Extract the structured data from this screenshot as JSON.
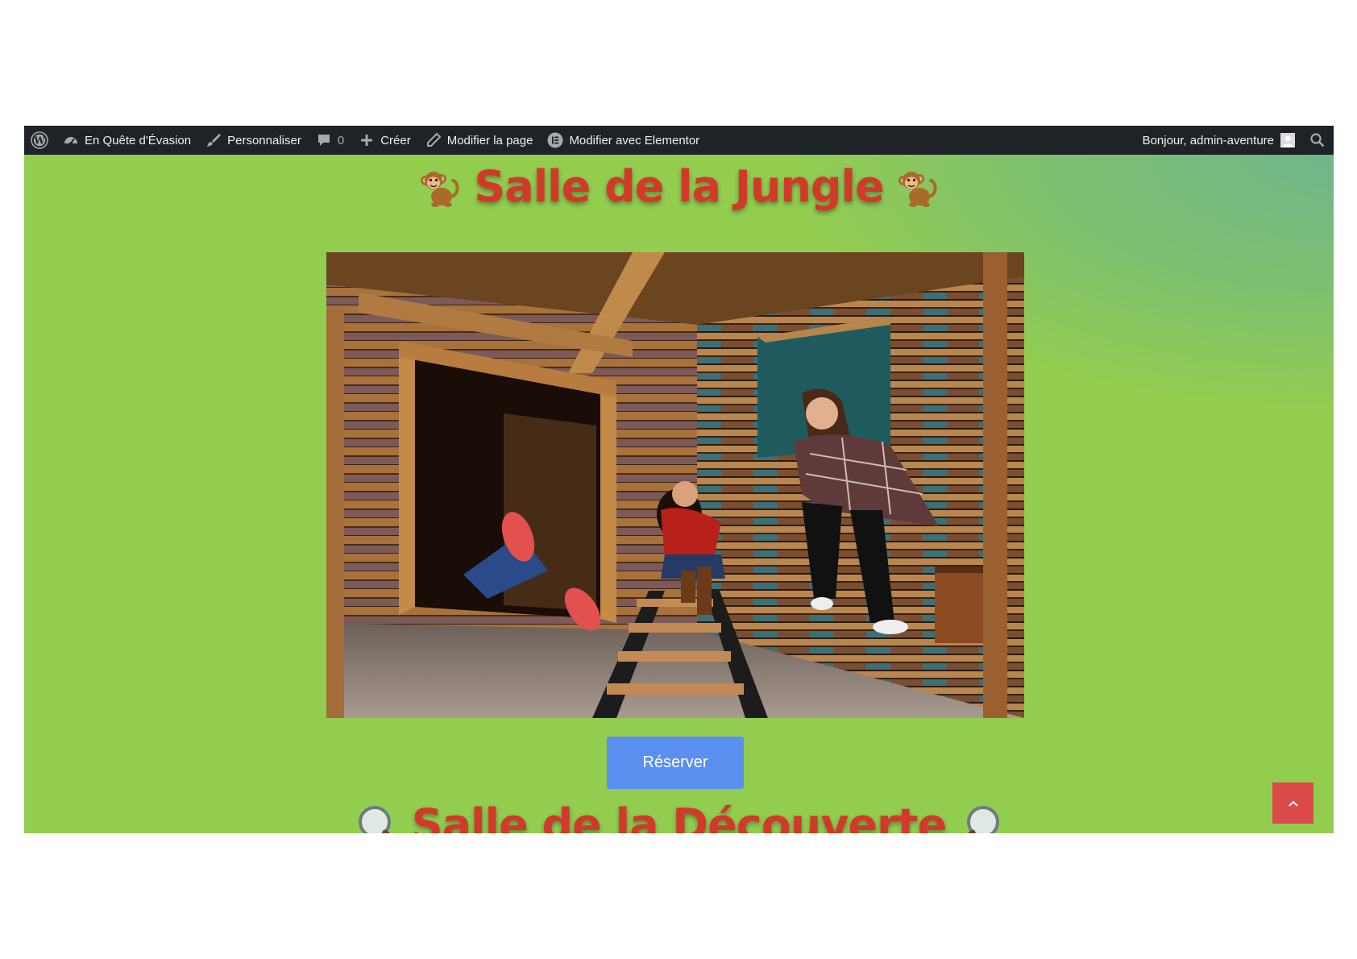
{
  "admin_bar": {
    "site_name": "En Quête d'Évasion",
    "customize": "Personnaliser",
    "comments_count": "0",
    "new": "Créer",
    "edit_page": "Modifier la page",
    "edit_elementor": "Modifier avec Elementor",
    "greeting": "Bonjour, admin-aventure"
  },
  "rooms": {
    "jungle_title": "Salle de la Jungle",
    "discovery_title": "Salle de la Découverte",
    "reserve_label": "Réserver"
  },
  "colors": {
    "background": "#92cd50",
    "title": "#d13a2a",
    "button": "#5b8ff0",
    "scroll_top": "#da4a4a",
    "admin_bar": "#1d2327"
  }
}
